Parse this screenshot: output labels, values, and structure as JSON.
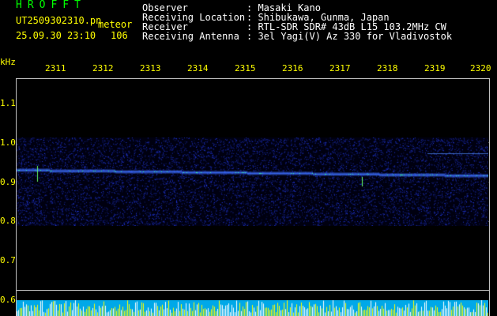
{
  "header": {
    "app_title": "HROFFT",
    "filename": "UT2509302310.pn",
    "mode": "meteor",
    "datetime": "25.09.30 23:10",
    "count": "106"
  },
  "info": {
    "observer_label": "Observer",
    "observer_value": ": Masaki Kano",
    "location_label": "Receiving Location",
    "location_value": ": Shibukawa, Gunma, Japan",
    "receiver_label": "Receiver",
    "receiver_value": ": RTL-SDR SDR# 43dB L15 103.2MHz CW",
    "antenna_label": "Receiving Antenna",
    "antenna_value": ": 3el Yagi(V) Az 330 for Vladivostok"
  },
  "axis": {
    "unit": "kHz",
    "x_ticks": [
      "2311",
      "2312",
      "2313",
      "2314",
      "2315",
      "2316",
      "2317",
      "2318",
      "2319",
      "2320"
    ],
    "y_ticks": [
      "1.1",
      "1.0",
      "0.9",
      "0.8",
      "0.7",
      "0.6"
    ]
  },
  "colors": {
    "background": "#000000",
    "title": "#00ff00",
    "label": "#ffff00",
    "text": "#ffffff",
    "signal": "#2233ff",
    "echo": "#00ff99",
    "bar": "#00a8e8"
  }
}
